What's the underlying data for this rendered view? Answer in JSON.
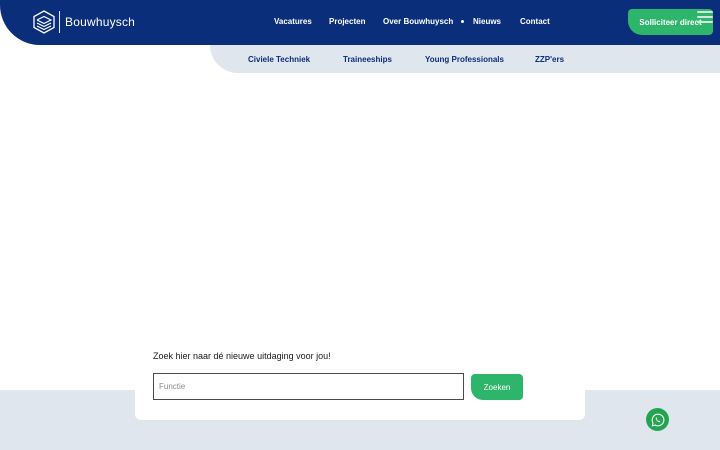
{
  "brand": {
    "name": "Bouwhuysch",
    "logo_icon": "hexagon-layers-icon"
  },
  "nav": {
    "items": [
      "Vacatures",
      "Projecten",
      "Over Bouwhuysch",
      "Nieuws",
      "Contact"
    ],
    "cta_label": "Solliciteer direct"
  },
  "subnav": {
    "items": [
      "Civiele Techniek",
      "Traineeships",
      "Young Professionals",
      "ZZP'ers"
    ]
  },
  "search": {
    "title": "Zoek hier naar dé nieuwe uitdaging voor jou!",
    "placeholder": "Functie",
    "value": "",
    "button_label": "Zoeken"
  },
  "colors": {
    "primary": "#0a2e7a",
    "accent": "#2db56b",
    "band": "#dfe6ee",
    "whatsapp": "#22a450"
  }
}
